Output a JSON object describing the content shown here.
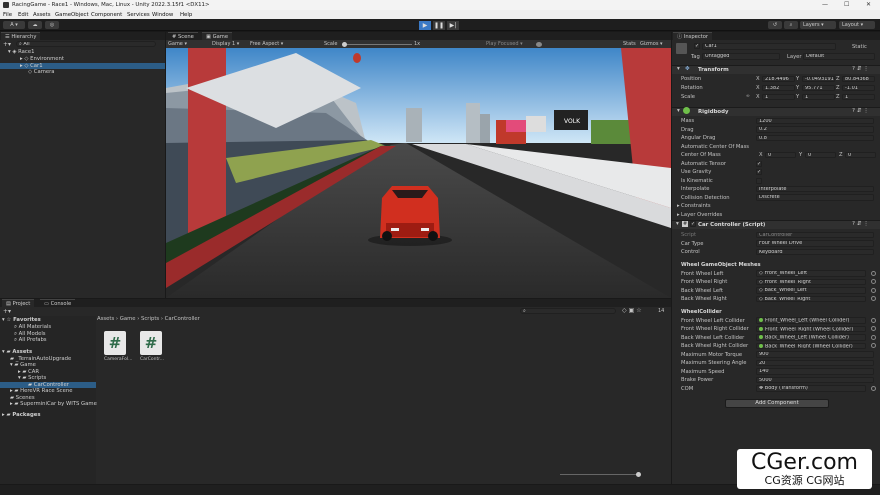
{
  "window": {
    "title": "RacingGame - Race1 - Windows, Mac, Linux - Unity 2022.3.15f1 <DX11>",
    "minimize": "—",
    "maximize": "☐",
    "close": "✕"
  },
  "menu": [
    "File",
    "Edit",
    "Assets",
    "GameObject",
    "Component",
    "Services",
    "Window",
    "Help"
  ],
  "toolbar": {
    "account": "A ▾",
    "layers": "Layers",
    "layout": "Layout"
  },
  "hierarchy": {
    "tab": "Hierarchy",
    "search_placeholder": "All",
    "items": [
      {
        "label": "Race1"
      },
      {
        "label": "Environment"
      },
      {
        "label": "Car1"
      },
      {
        "label": "Camera"
      }
    ]
  },
  "game": {
    "tabs": [
      "Scene",
      "Game"
    ],
    "display_mode": "Game",
    "display": "Display 1",
    "aspect": "Free Aspect",
    "scale_label": "Scale",
    "scale_value": "1x",
    "play_focused": "Play Focused",
    "stats": "Stats",
    "gizmos": "Gizmos",
    "billboard": "VOLK"
  },
  "project": {
    "tabs": [
      "Project",
      "Console"
    ],
    "count": "14",
    "favorites": {
      "label": "Favorites",
      "items": [
        "All Materials",
        "All Models",
        "All Prefabs"
      ]
    },
    "assets": {
      "label": "Assets",
      "items": [
        "_TerrainAutoUpgrade",
        "Game",
        "CAR",
        "Scripts",
        "CarController",
        "HereVR Race Scene",
        "Scenes",
        "SuperminiCar by WITS Game"
      ]
    },
    "packages": "Packages",
    "breadcrumb": [
      "Assets",
      "Game",
      "Scripts",
      "CarController"
    ],
    "files": [
      "CameraFol...",
      "CarContr..."
    ]
  },
  "inspector": {
    "tab": "Inspector",
    "object": {
      "name": "Car1",
      "static": "Static",
      "tag_label": "Tag",
      "tag": "Untagged",
      "layer_label": "Layer",
      "layer": "Default"
    },
    "transform": {
      "title": "Transform",
      "position": [
        "218.4496",
        "-0.0493191",
        "80.84368"
      ],
      "rotation": [
        "1.382",
        "95.771",
        "-1.01"
      ],
      "scale": [
        "1",
        "1",
        "1"
      ],
      "labels": [
        "Position",
        "Rotation",
        "Scale"
      ],
      "axes": [
        "X",
        "Y",
        "Z"
      ]
    },
    "rigidbody": {
      "title": "Rigidbody",
      "fields": [
        {
          "label": "Mass",
          "value": "1200"
        },
        {
          "label": "Drag",
          "value": "0.2"
        },
        {
          "label": "Angular Drag",
          "value": "0.8"
        }
      ],
      "auto_com": "Automatic Center Of Mass",
      "com_label": "Center Of Mass",
      "com": [
        "0",
        "0",
        "0"
      ],
      "auto_tensor": "Automatic Tensor",
      "use_gravity": "Use Gravity",
      "is_kinematic": "Is Kinematic",
      "interpolate_label": "Interpolate",
      "interpolate": "Interpolate",
      "collision_label": "Collision Detection",
      "collision": "Discrete",
      "constraints": "Constraints",
      "layer_overrides": "Layer Overrides"
    },
    "car_controller": {
      "title": "Car Controller (Script)",
      "script_label": "Script",
      "script": "CarController",
      "car_type_label": "Car Type",
      "car_type": "Four Wheel Drive",
      "control_label": "Control",
      "control": "Keyboard",
      "meshes_title": "Wheel GameObject Meshes",
      "meshes": [
        {
          "label": "Front Wheel Left",
          "value": "Front_Wheel_Left"
        },
        {
          "label": "Front Wheel Right",
          "value": "Front_Wheel_Right"
        },
        {
          "label": "Back Wheel Left",
          "value": "Back_Wheel_Left"
        },
        {
          "label": "Back Wheel Right",
          "value": "Back_Wheel_Right"
        }
      ],
      "collider_title": "WheelCollider",
      "colliders": [
        {
          "label": "Front Wheel Left Collider",
          "value": "Front_Wheel_Left (Wheel Collider)"
        },
        {
          "label": "Front Wheel Right Collider",
          "value": "Front_Wheel_Right (Wheel Collider)"
        },
        {
          "label": "Back Wheel Left Collider",
          "value": "Back_Wheel_Left (Wheel Collider)"
        },
        {
          "label": "Back Wheel Right Collider",
          "value": "Back_Wheel_Right (Wheel Collider)"
        }
      ],
      "params": [
        {
          "label": "Maximum Motor Torque",
          "value": "900"
        },
        {
          "label": "Maximum Steering Angle",
          "value": "20"
        },
        {
          "label": "Maximum Speed",
          "value": "140"
        },
        {
          "label": "Brake Power",
          "value": "5000"
        },
        {
          "label": "COM",
          "value": "Body (Transform)"
        }
      ]
    },
    "add_component": "Add Component"
  },
  "watermark": {
    "brand": "CGer.com",
    "sub": "CG资源 CG网站"
  },
  "colors": {
    "accent": "#2c5d87",
    "play": "#3a79c5"
  }
}
